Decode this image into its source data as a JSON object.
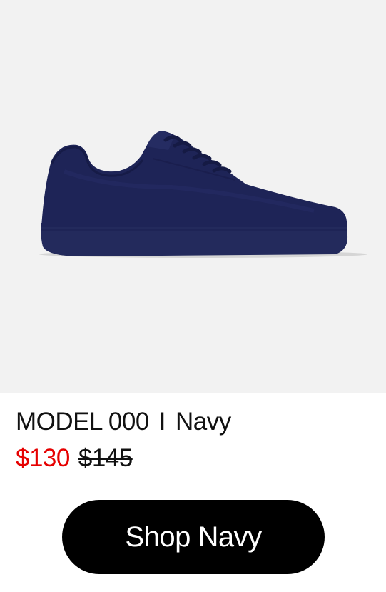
{
  "product": {
    "image_alt": "Navy knit low-top sneaker",
    "model": "MODEL 000",
    "separator": "I",
    "color": "Navy",
    "price_sale": "$130",
    "price_original": "$145",
    "cta_label": "Shop Navy"
  },
  "colors": {
    "sale": "#e60000",
    "button": "#000000",
    "shoe": "#1e2457",
    "hero_bg": "#f2f2f2"
  }
}
